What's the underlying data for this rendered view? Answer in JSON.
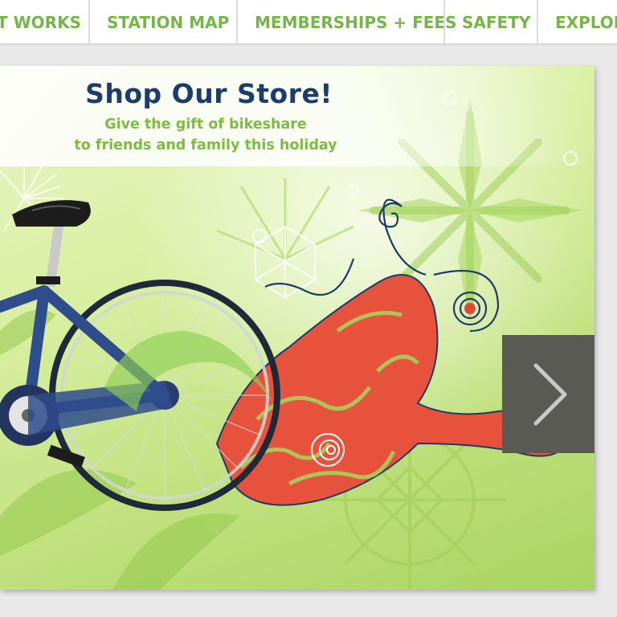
{
  "nav": {
    "items": [
      {
        "label": "T WORKS"
      },
      {
        "label": "STATION MAP"
      },
      {
        "label": "MEMBERSHIPS + FEES"
      },
      {
        "label": "SAFETY"
      },
      {
        "label": "EXPLOR"
      }
    ]
  },
  "banner": {
    "title": "Shop Our Store!",
    "subtitle_line1": "Give the gift of bikeshare",
    "subtitle_line2": "to friends and family this holiday",
    "next_icon": "chevron-right-icon"
  },
  "colors": {
    "nav_text": "#76b648",
    "title": "#1b3d6e",
    "subtitle": "#7cbc3f",
    "next_button": "#5a5a55"
  }
}
